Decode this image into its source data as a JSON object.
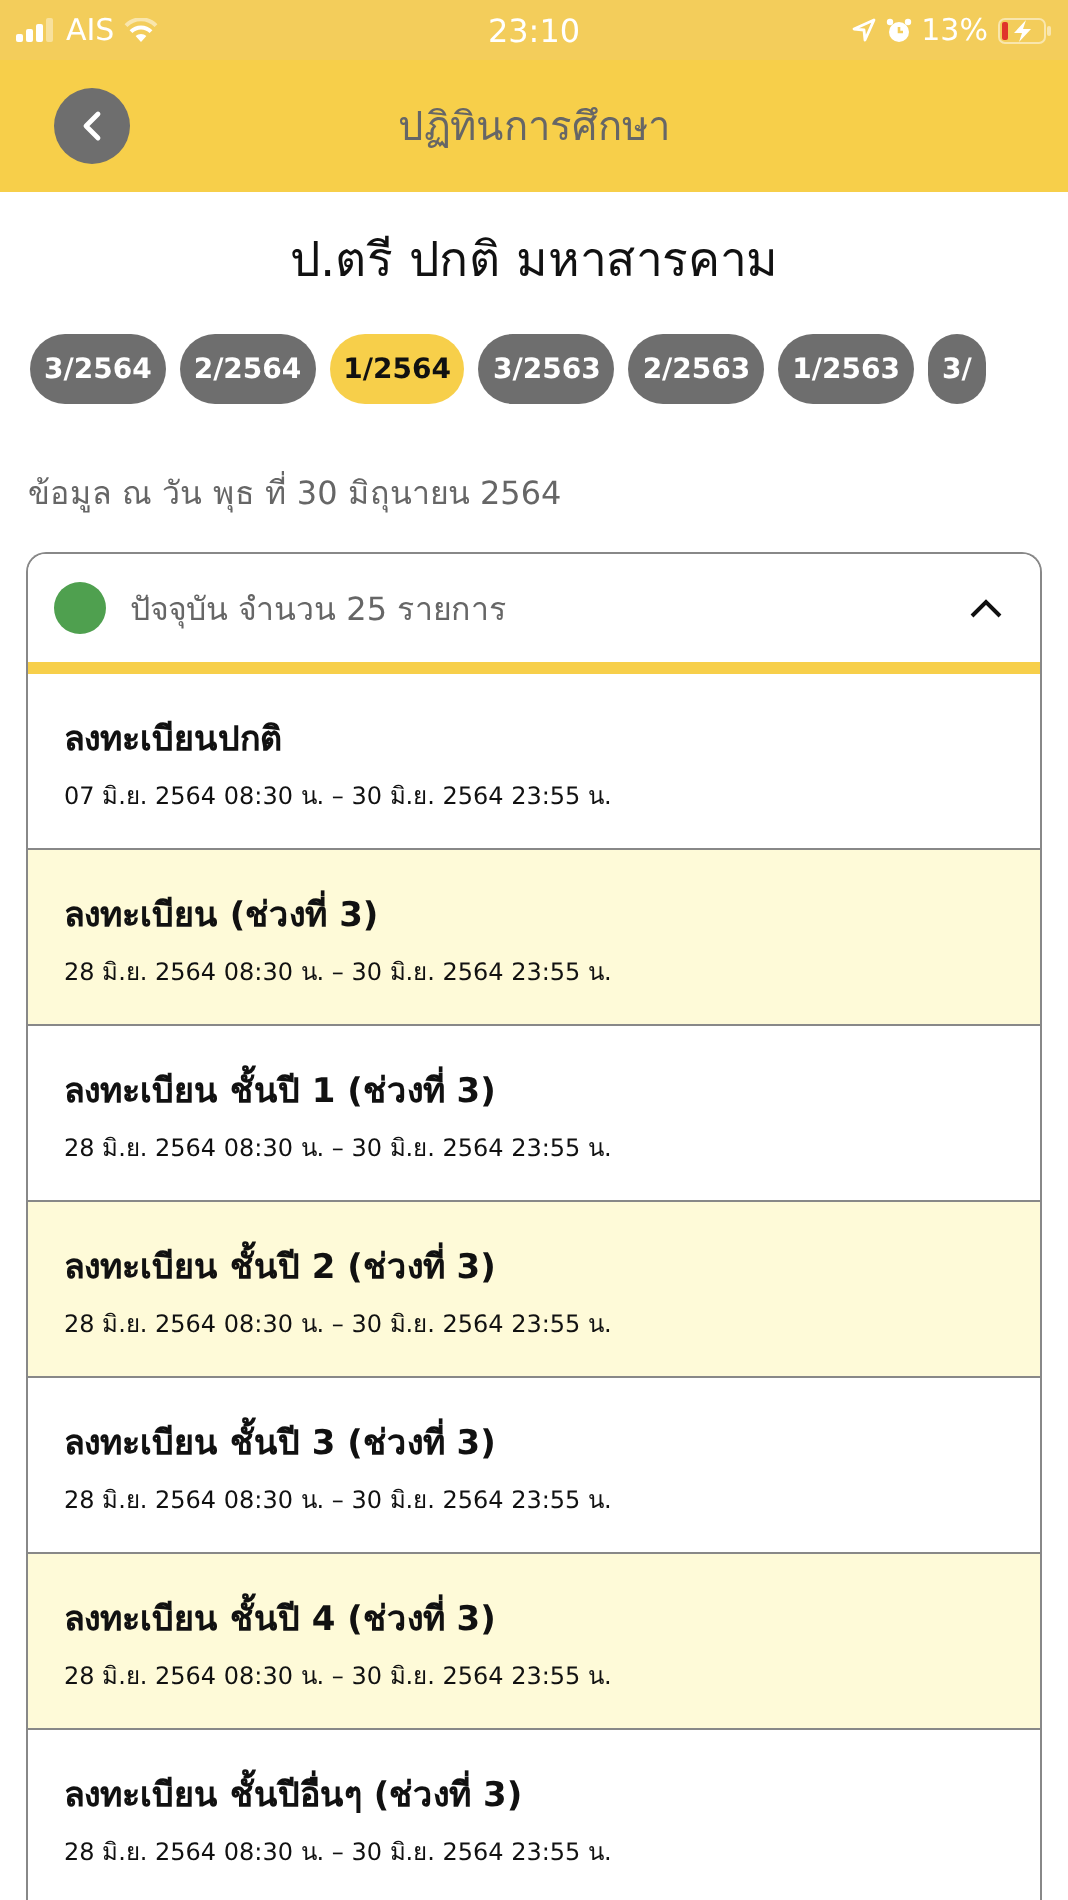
{
  "status_bar": {
    "carrier": "AIS",
    "time": "23:10",
    "battery": "13%"
  },
  "header": {
    "title": "ปฏิทินการศึกษา"
  },
  "page_title": "ป.ตรี ปกติ มหาสารคาม",
  "tabs": [
    {
      "label": "3/2564",
      "selected": false
    },
    {
      "label": "2/2564",
      "selected": false
    },
    {
      "label": "1/2564",
      "selected": true
    },
    {
      "label": "3/2563",
      "selected": false
    },
    {
      "label": "2/2563",
      "selected": false
    },
    {
      "label": "1/2563",
      "selected": false
    },
    {
      "label": "3/",
      "selected": false
    }
  ],
  "as_of": "ข้อมูล ณ วัน พุธ ที่ 30 มิถุนายน 2564",
  "section": {
    "label": "ปัจจุบัน จำนวน 25 รายการ",
    "color": "#4fa04f",
    "expanded": true,
    "items": [
      {
        "title": "ลงทะเบียนปกติ",
        "dates": "07 มิ.ย. 2564 08:30 น. – 30 มิ.ย. 2564 23:55 น."
      },
      {
        "title": "ลงทะเบียน (ช่วงที่ 3)",
        "dates": "28 มิ.ย. 2564 08:30 น. – 30 มิ.ย. 2564 23:55 น."
      },
      {
        "title": "ลงทะเบียน ชั้นปี 1 (ช่วงที่ 3)",
        "dates": "28 มิ.ย. 2564 08:30 น. – 30 มิ.ย. 2564 23:55 น."
      },
      {
        "title": "ลงทะเบียน ชั้นปี 2 (ช่วงที่ 3)",
        "dates": "28 มิ.ย. 2564 08:30 น. – 30 มิ.ย. 2564 23:55 น."
      },
      {
        "title": "ลงทะเบียน ชั้นปี 3 (ช่วงที่ 3)",
        "dates": "28 มิ.ย. 2564 08:30 น. – 30 มิ.ย. 2564 23:55 น."
      },
      {
        "title": "ลงทะเบียน ชั้นปี 4 (ช่วงที่ 3)",
        "dates": "28 มิ.ย. 2564 08:30 น. – 30 มิ.ย. 2564 23:55 น."
      },
      {
        "title": "ลงทะเบียน ชั้นปีอื่นๆ (ช่วงที่ 3)",
        "dates": "28 มิ.ย. 2564 08:30 น. – 30 มิ.ย. 2564 23:55 น."
      }
    ]
  }
}
